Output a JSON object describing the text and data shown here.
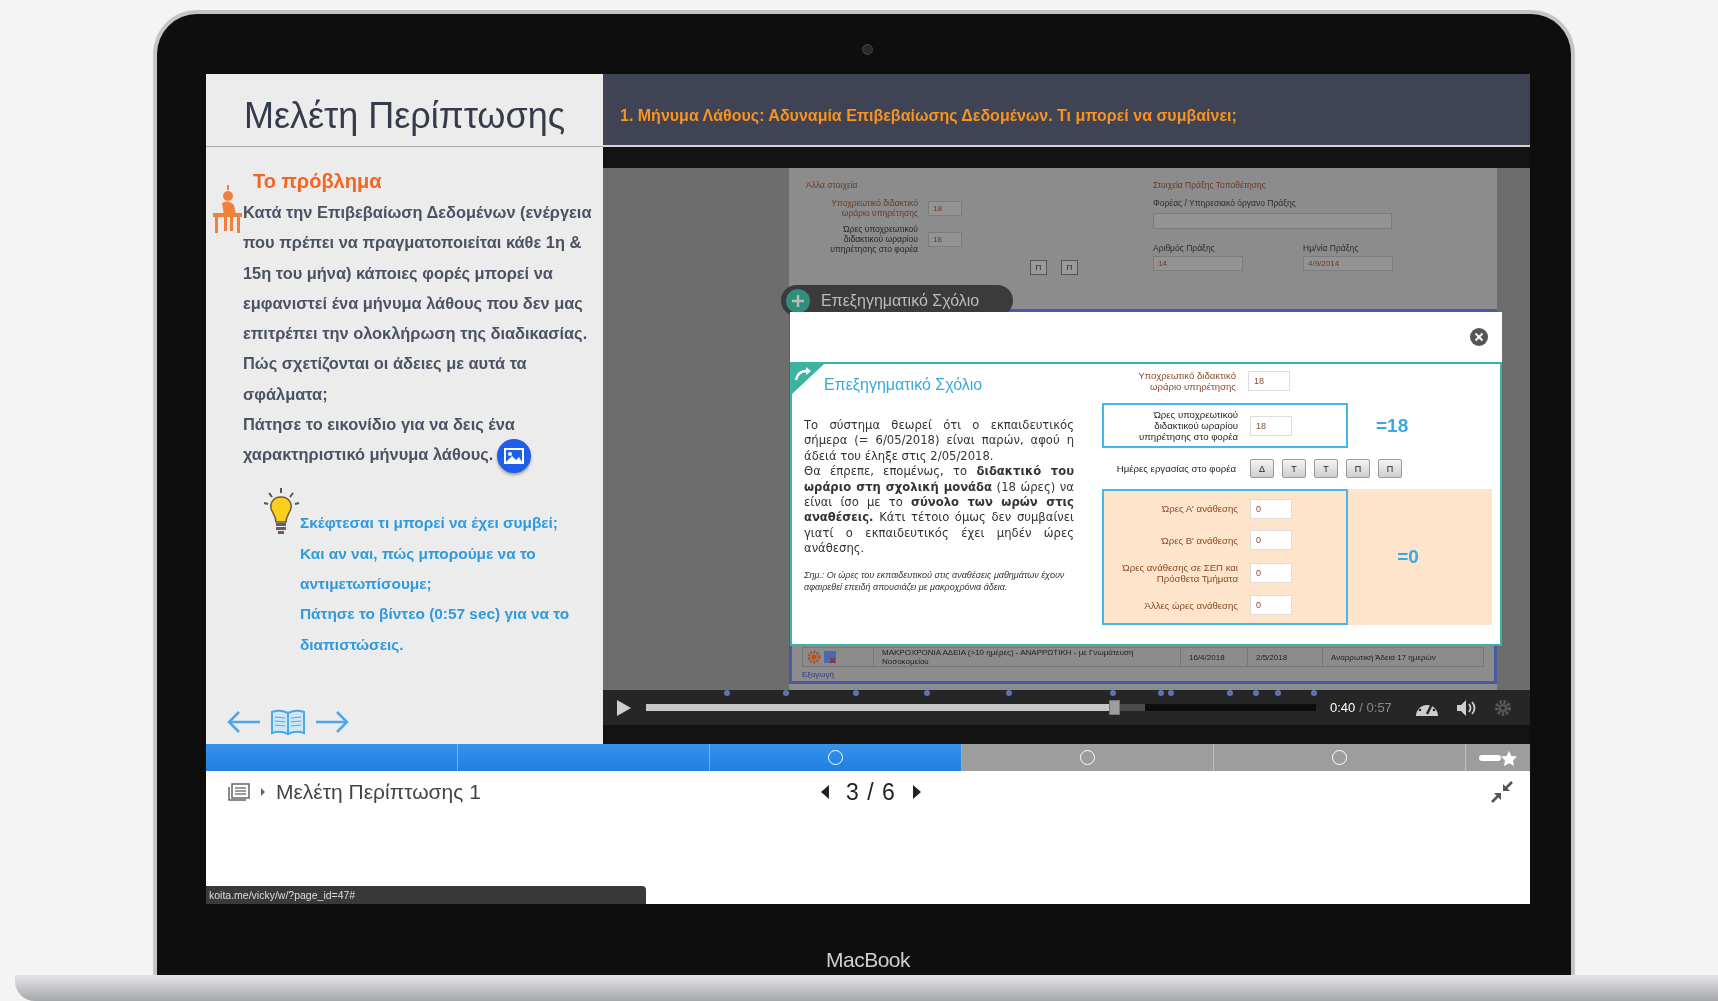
{
  "laptop": {
    "label": "MacBook"
  },
  "lesson": {
    "title": "Μελέτη Περίπτωσης",
    "heading": "Το πρόβλημα",
    "paragraphs": [
      "Κατά την Επιβεβαίωση Δεδομένων (ενέργεια που πρέπει να πραγματοποιείται κάθε 1η & 15η του μήνα) κάποιες φορές μπορεί να εμφανιστεί ένα μήνυμα λάθους που δεν μας επιτρέπει την ολοκλήρωση της διαδικασίας.",
      "Πώς σχετίζονται οι άδειες με αυτά τα σφάλματα;",
      "Πάτησε το εικονίδιο για να δεις ένα χαρακτηριστικό μήνυμα λάθους."
    ],
    "tips": [
      "Σκέφτεσαι τι μπορεί να έχει συμβεί;",
      "Και αν ναι, πώς μπορούμε να το αντιμετωπίσουμε;",
      "Πάτησε το βίντεο (0:57 sec) για να το διαπιστώσεις."
    ]
  },
  "slide_title": "1. Μήνυμα Λάθους: Αδυναμία Επιβεβαίωσης Δεδομένων. Τι μπορεί να συμβαίνει;",
  "video": {
    "form": {
      "left_section": "Άλλα στοιχεία",
      "fields": [
        {
          "label": "Υποχρεωτικό διδακτικό ωράριο υπηρέτησης",
          "value": "18",
          "kind": "required"
        },
        {
          "label": "Ώρες υποχρεωτικού διδακτικού ωραρίου υπηρέτησης στο φορέα",
          "value": "18",
          "kind": "plain"
        }
      ],
      "day_buttons": [
        "Π",
        "Π"
      ],
      "right_section": "Στοιχεία Πράξης Τοποθέτησης",
      "agency_label": "Φορέας / Υπηρεσιακό όργανο Πράξης",
      "act_number": {
        "label": "Αριθμός Πράξης",
        "value": "14"
      },
      "act_date": {
        "label": "Ημ/νία Πράξης",
        "value": "4/9/2014"
      },
      "table_row": [
        "ΜΑΚΡΟΧΡΟΝΙΑ ΑΔΕΙΑ (>10 ημέρες) - ΑΝΑΡΡΩΤΙΚΗ - με Γνωμάτευση Νοσοκομείου",
        "16/4/2018",
        "2/5/2018",
        "Αναρρωτική Άδεια 17 ημερών"
      ],
      "export_link": "Εξαγωγή"
    },
    "badge": "Επεξηγηματικό Σχόλιο",
    "modal": {
      "title": "Επεξηγηματικό Σχόλιο",
      "paragraphs": [
        "Το σύστημα θεωρεί ότι ο εκπαιδευτικός σήμερα (= 6/05/2018) είναι παρών, αφού η άδειά του έληξε στις 2/05/2018.",
        "Θα έπρεπε, επομένως, το **διδακτικό του ωράριο στη σχολική μονάδα** (18 ώρες) να είναι ίσο με το **σύνολο των ωρών στις αναθέσεις.** Κάτι τέτοιο όμως δεν συμβαίνει γιατί ο εκπαιδευτικός έχει μηδέν ώρες ανάθεσης."
      ],
      "note": "Σημ.: Οι ώρες του  εκπαιδευτικού στις αναθέσεις μαθημάτων έχουν αφαιρεθεί επειδή απουσιάζει με μακροχρόνια άδεια.",
      "field": {
        "label": "Υποχρεωτικό διδακτικό ωράριο υπηρέτησης",
        "value": "18"
      },
      "highlight": {
        "label": "Ώρες υποχρεωτικού διδακτικού ωραρίου υπηρέτησης στο φορέα",
        "value": "18",
        "total": "=18"
      },
      "days": {
        "label": "Ημέρες εργασίας στο φορέα",
        "buttons": [
          "Δ",
          "Τ",
          "Τ",
          "Π",
          "Π"
        ]
      },
      "assignments": [
        {
          "label": "Ώρες Α' ανάθεσης",
          "value": "0"
        },
        {
          "label": "Ώρες Β' ανάθεσης",
          "value": "0"
        },
        {
          "label": "Ώρες ανάθεσης σε ΣΕΠ και Πρόσθετα Τμήματα",
          "value": "0"
        },
        {
          "label": "Άλλες ώρες ανάθεσης",
          "value": "0"
        }
      ],
      "assignments_total": "=0"
    },
    "player": {
      "level": 0.7,
      "current_time": "0:40",
      "duration": "/ 0:57"
    }
  },
  "progress_segments": [
    {
      "completed": true,
      "marker": false
    },
    {
      "completed": true,
      "marker": false
    },
    {
      "completed": true,
      "marker": true
    },
    {
      "completed": false,
      "marker": true
    },
    {
      "completed": false,
      "marker": true
    }
  ],
  "footer": {
    "breadcrumb": "Μελέτη Περίπτωσης 1",
    "page": "3 / 6"
  },
  "status_url": "koita.me/vicky/w/?page_id=47#"
}
